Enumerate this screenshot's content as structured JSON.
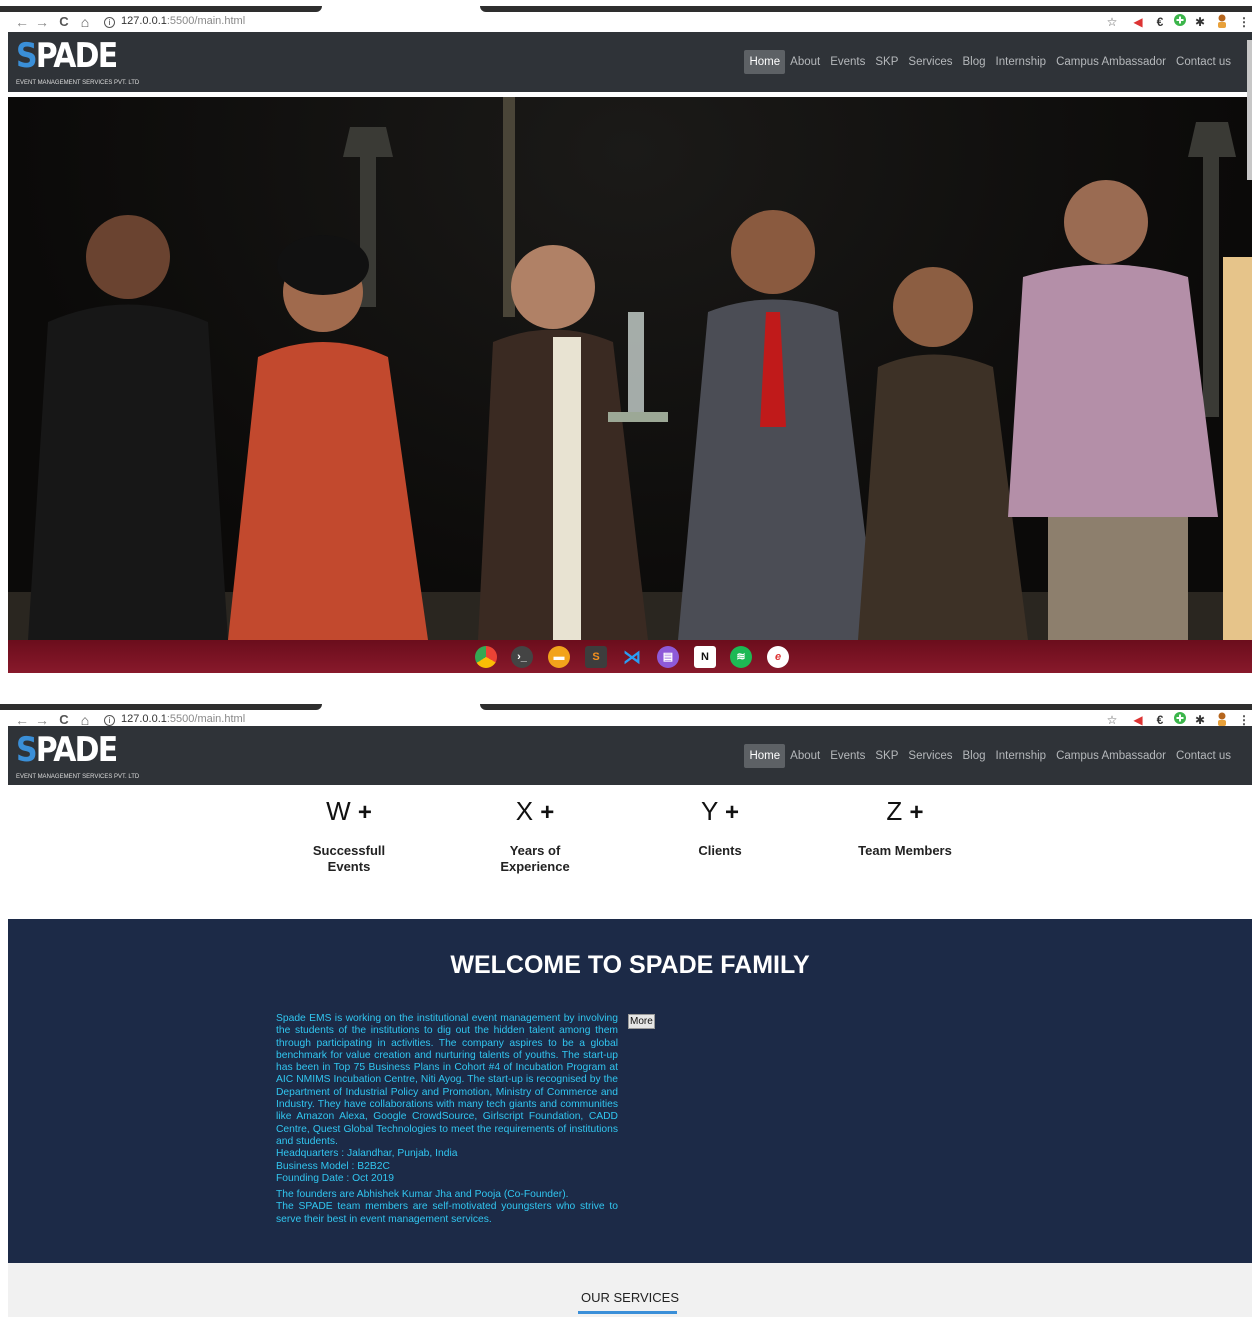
{
  "browser": {
    "back_icon": "←",
    "forward_icon": "→",
    "reload_icon": "C",
    "home_icon": "⌂",
    "url_info_icon": "i",
    "url_host": "127.0.0.1",
    "url_path": ":5500/main.html",
    "menu_icon": "⋮"
  },
  "site": {
    "logo_text": "SPADE",
    "logo_tagline": "EVENT MANAGEMENT SERVICES PVT. LTD",
    "nav": [
      {
        "label": "Home"
      },
      {
        "label": "About"
      },
      {
        "label": "Events"
      },
      {
        "label": "SKP"
      },
      {
        "label": "Services"
      },
      {
        "label": "Blog"
      },
      {
        "label": "Internship"
      },
      {
        "label": "Campus Ambassador"
      },
      {
        "label": "Contact us"
      }
    ]
  },
  "stats": [
    {
      "value": "W",
      "plus": "+",
      "label": "Successfull Events"
    },
    {
      "value": "X",
      "plus": "+",
      "label": "Years of Experience"
    },
    {
      "value": "Y",
      "plus": "+",
      "label": "Clients"
    },
    {
      "value": "Z",
      "plus": "+",
      "label": "Team Members"
    }
  ],
  "welcome": {
    "title": "WELCOME TO SPADE FAMILY",
    "paragraph": "Spade EMS is working on the institutional event management by involving the students of the institutions to dig out the hidden talent among them through participating in activities. The company aspires to be a global benchmark for value creation and nurturing talents of youths. The start-up has been in Top 75 Business Plans in Cohort #4 of Incubation Program at AIC NMIMS Incubation Centre, Niti Ayog. The start-up is recognised by the Department of Industrial Policy and Promotion, Ministry of Commerce and Industry. They have collaborations with many tech giants and communities like Amazon Alexa, Google CrowdSource, Girlscript Foundation, CADD Centre, Quest Global Technologies to meet the requirements of institutions and students.",
    "headquarters": "Headquarters : Jalandhar, Punjab, India",
    "business_model": "Business Model : B2B2C",
    "founding_date": "Founding Date : Oct 2019",
    "founders": "The founders are Abhishek Kumar Jha and Pooja (Co-Founder).",
    "team": "The SPADE team members are self-motivated youngsters who strive to serve their best in event management services.",
    "more_label": "More"
  },
  "services": {
    "title": "OUR SERVICES"
  },
  "colors": {
    "navbar": "#2f3338",
    "welcome_bg": "#1c2a47",
    "welcome_text": "#31c6f0",
    "accent": "#3a8fd8",
    "dock": "#7a1222"
  }
}
